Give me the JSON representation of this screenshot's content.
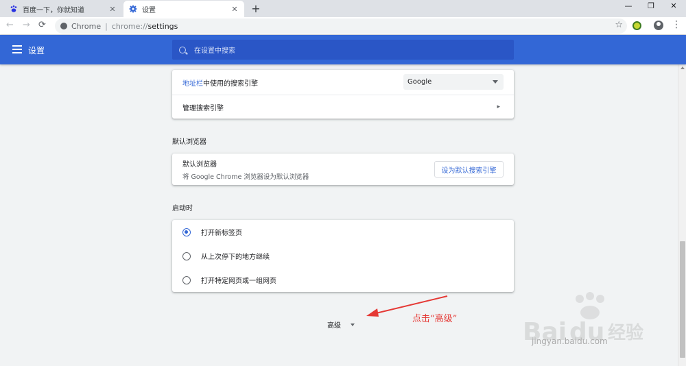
{
  "browser": {
    "tabs": [
      {
        "title": "百度一下，你就知道",
        "icon": "baidu-paw-icon"
      },
      {
        "title": "设置",
        "icon": "gear-icon"
      }
    ],
    "new_tab": "+",
    "window_controls": {
      "minimize": "—",
      "maximize": "❐",
      "close": "✕"
    },
    "address": {
      "site": "Chrome",
      "scheme": "chrome://",
      "path": "settings"
    },
    "nav_icons": {
      "back": "←",
      "forward": "→",
      "reload": "⟳",
      "star": "☆",
      "menu": "⋮"
    }
  },
  "header": {
    "title": "设置",
    "search_placeholder": "在设置中搜索"
  },
  "search_engine": {
    "address_bar_label_link": "地址栏",
    "address_bar_label_rest": "中使用的搜索引擎",
    "selected": "Google",
    "manage_label": "管理搜索引擎"
  },
  "default_browser": {
    "section_title": "默认浏览器",
    "label": "默认浏览器",
    "sublabel": "将 Google Chrome 浏览器设为默认浏览器",
    "button": "设为默认搜索引擎"
  },
  "startup": {
    "section_title": "启动时",
    "options": [
      {
        "label": "打开新标签页",
        "selected": true
      },
      {
        "label": "从上次停下的地方继续",
        "selected": false
      },
      {
        "label": "打开特定网页或一组网页",
        "selected": false
      }
    ]
  },
  "advanced": {
    "label": "高级"
  },
  "annotation": {
    "text": "点击“高级”",
    "color": "#e53935"
  },
  "watermark": {
    "text": "jingyan.baidu.com"
  },
  "colors": {
    "accent": "#3367d6",
    "header": "#3367d6",
    "search_bg": "#2a56c6"
  }
}
